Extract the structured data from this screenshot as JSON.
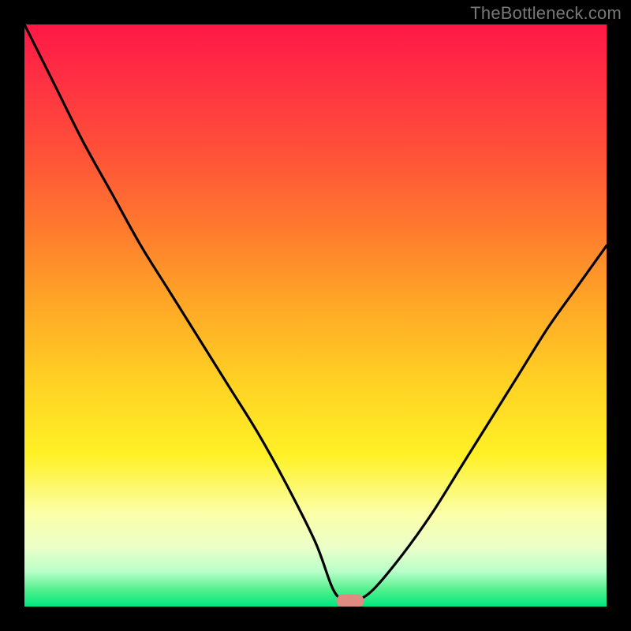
{
  "watermark": "TheBottleneck.com",
  "chart_data": {
    "type": "line",
    "title": "",
    "xlabel": "",
    "ylabel": "",
    "xlim": [
      0,
      100
    ],
    "ylim": [
      0,
      100
    ],
    "grid": false,
    "legend": false,
    "series": [
      {
        "name": "bottleneck-curve",
        "x": [
          0,
          5,
          10,
          15,
          20,
          25,
          30,
          35,
          40,
          45,
          50,
          53,
          55,
          57,
          60,
          65,
          70,
          75,
          80,
          85,
          90,
          95,
          100
        ],
        "values": [
          100,
          90,
          80,
          71,
          62,
          54,
          46,
          38,
          30,
          21,
          11,
          3,
          1,
          1,
          3,
          9,
          16,
          24,
          32,
          40,
          48,
          55,
          62
        ]
      }
    ],
    "marker": {
      "x": 56,
      "y": 1
    },
    "colors": {
      "curve": "#000000",
      "marker": "#e08b82",
      "frame": "#000000",
      "gradient_top": "#ff1846",
      "gradient_bottom": "#00e77d"
    }
  }
}
